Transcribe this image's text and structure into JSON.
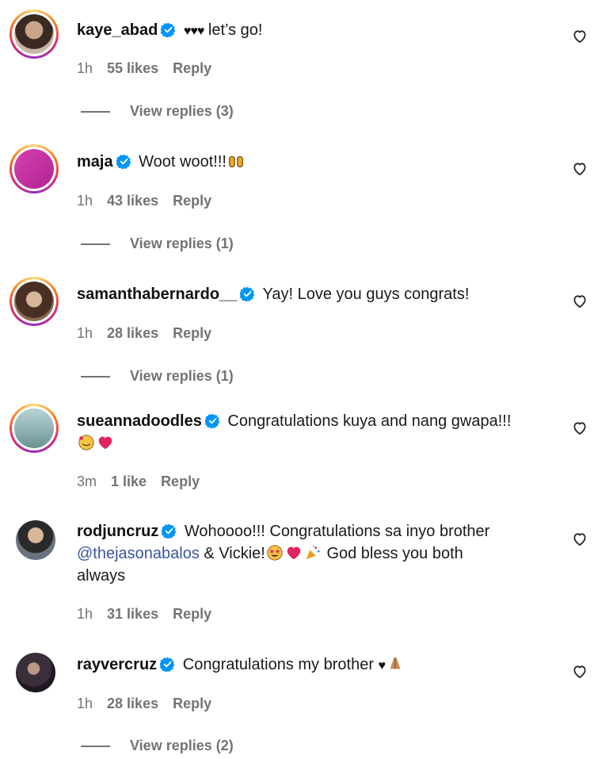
{
  "comments": [
    {
      "username": "kaye_abad",
      "text": "let’s go!",
      "time": "1h",
      "likes": "55 likes",
      "reply": "Reply",
      "view_replies": "View replies (3)"
    },
    {
      "username": "maja",
      "text": "Woot woot!!!",
      "time": "1h",
      "likes": "43 likes",
      "reply": "Reply",
      "view_replies": "View replies (1)"
    },
    {
      "username": "samanthabernardo__",
      "text": "Yay! Love you guys congrats!",
      "time": "1h",
      "likes": "28 likes",
      "reply": "Reply",
      "view_replies": "View replies (1)"
    },
    {
      "username": "sueannadoodles",
      "text": "Congratulations kuya and nang gwapa!!!",
      "time": "3m",
      "likes": "1 like",
      "reply": "Reply"
    },
    {
      "username": "rodjuncruz",
      "text_a": "Wohoooo!!! Congratulations sa inyo brother",
      "mention": "@thejasonabalos",
      "text_b": "& Vickie!",
      "text_c": "God bless you both",
      "text_d": "always",
      "time": "1h",
      "likes": "31 likes",
      "reply": "Reply"
    },
    {
      "username": "rayvercruz",
      "text": "Congratulations my brother",
      "time": "1h",
      "likes": "28 likes",
      "reply": "Reply",
      "view_replies": "View replies (2)"
    }
  ],
  "icons": {
    "verified": "verified-badge-icon",
    "like": "heart-outline-icon"
  },
  "colors": {
    "verified": "#0095f6",
    "mention": "#3a55a0",
    "meta": "#737373"
  }
}
